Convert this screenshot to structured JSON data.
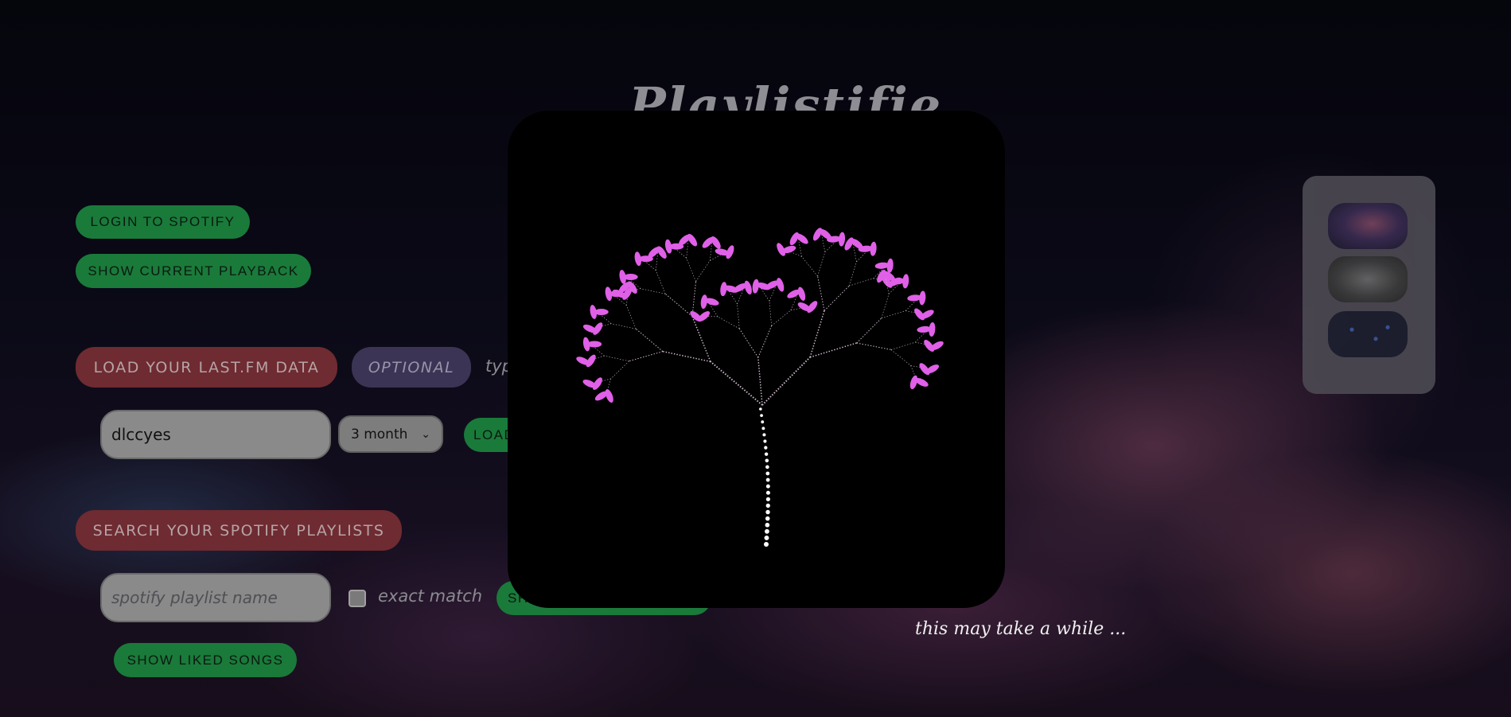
{
  "app": {
    "title": "Playlistifie"
  },
  "spotify": {
    "login_label": "LOGIN TO SPOTIFY",
    "playback_label": "SHOW CURRENT PLAYBACK"
  },
  "lastfm": {
    "section_label": "LOAD YOUR LAST.FM DATA",
    "optional_label": "OPTIONAL",
    "type_hint": "typ",
    "username_value": "dlccyes",
    "period_selected": "3 month",
    "load_label": "LOAD"
  },
  "playlists": {
    "section_label": "SEARCH YOUR SPOTIFY PLAYLISTS",
    "search_placeholder": "spotify playlist name",
    "exact_match_label": "exact match",
    "exact_match_checked": false,
    "show_label": "SH",
    "liked_label": "SHOW LIKED SONGS"
  },
  "background_selector": {
    "options": [
      "nebula-thumbnail",
      "gray-thumbnail",
      "starfield-thumbnail"
    ]
  },
  "loading": {
    "message": "this may take a while ...",
    "leaf_color": "#e060e8",
    "branch_color": "#c8b8c8"
  }
}
